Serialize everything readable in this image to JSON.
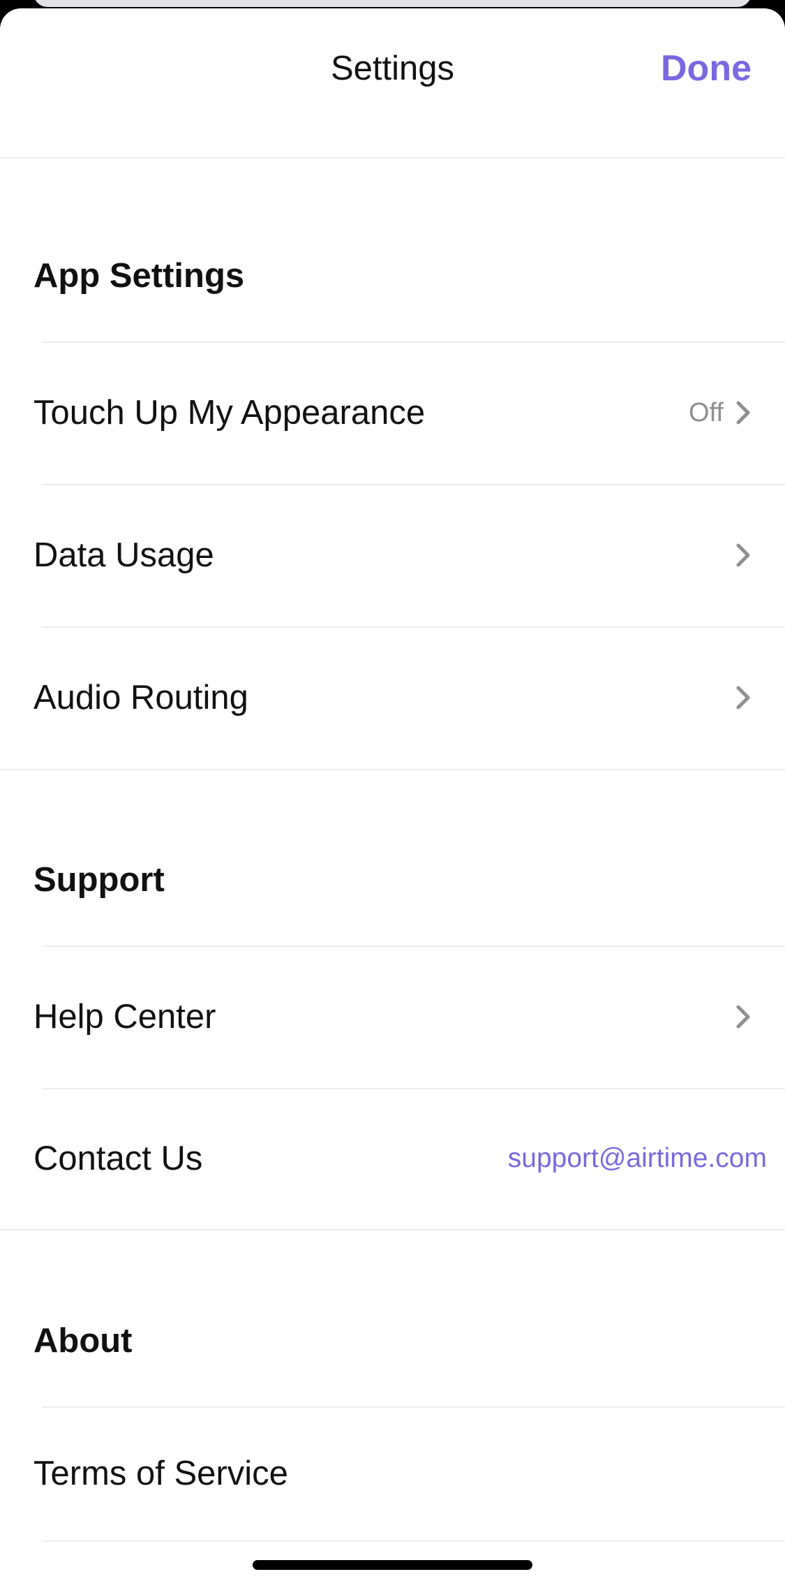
{
  "nav": {
    "title": "Settings",
    "done_label": "Done"
  },
  "sections": [
    {
      "header": "App Settings",
      "rows": [
        {
          "label": "Touch Up My Appearance",
          "value": "Off",
          "chevron": true
        },
        {
          "label": "Data Usage",
          "chevron": true
        },
        {
          "label": "Audio Routing",
          "chevron": true
        }
      ]
    },
    {
      "header": "Support",
      "rows": [
        {
          "label": "Help Center",
          "chevron": true
        },
        {
          "label": "Contact Us",
          "value": "support@airtime.com"
        }
      ]
    },
    {
      "header": "About",
      "rows": [
        {
          "label": "Terms of Service"
        }
      ]
    }
  ],
  "colors": {
    "accent": "#7b68e0",
    "separator": "#ededf0",
    "secondary_text": "#8e8e93",
    "chevron": "#8e8e93"
  },
  "icons": {
    "chevron": "chevron-right-icon"
  }
}
